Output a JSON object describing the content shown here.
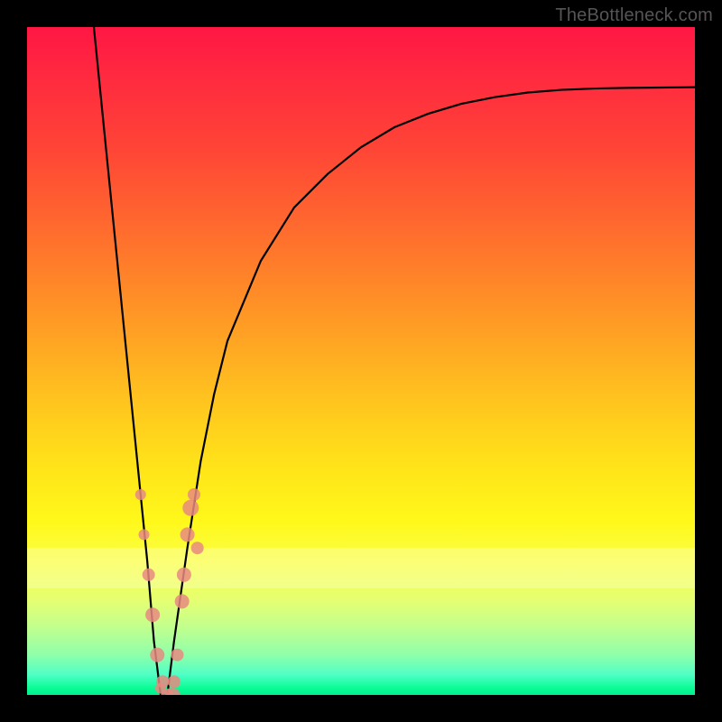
{
  "watermark": "TheBottleneck.com",
  "chart_data": {
    "type": "line",
    "title": "",
    "xlabel": "",
    "ylabel": "",
    "xlim": [
      0,
      100
    ],
    "ylim": [
      0,
      100
    ],
    "grid": false,
    "legend": false,
    "background_gradient": {
      "direction": "vertical",
      "stops": [
        {
          "pos": 0.0,
          "color": "#ff1744"
        },
        {
          "pos": 0.3,
          "color": "#ff6a2e"
        },
        {
          "pos": 0.55,
          "color": "#ffc11f"
        },
        {
          "pos": 0.74,
          "color": "#fff81a"
        },
        {
          "pos": 0.9,
          "color": "#c0ff8f"
        },
        {
          "pos": 1.0,
          "color": "#00f090"
        }
      ]
    },
    "series": [
      {
        "name": "bottleneck-curve",
        "color": "#000000",
        "x": [
          10,
          12,
          14,
          16,
          18,
          19,
          20,
          21,
          22,
          24,
          26,
          28,
          30,
          35,
          40,
          45,
          50,
          55,
          60,
          65,
          70,
          75,
          80,
          85,
          90,
          95,
          100
        ],
        "y": [
          100,
          80,
          60,
          40,
          20,
          8,
          0,
          0,
          8,
          22,
          35,
          45,
          53,
          65,
          73,
          78,
          82,
          85,
          87,
          88.5,
          89.5,
          90.2,
          90.6,
          90.8,
          90.9,
          90.95,
          91
        ]
      }
    ],
    "scatter_points": {
      "name": "marker-dots",
      "color": "#e88a80",
      "radius_px": [
        6,
        6,
        7,
        8,
        8,
        7,
        7,
        8,
        7,
        8,
        8,
        8,
        9,
        7,
        7,
        7,
        6
      ],
      "x": [
        17.0,
        17.5,
        18.2,
        18.8,
        19.5,
        20.3,
        21.0,
        21.8,
        22.5,
        23.2,
        23.5,
        24.0,
        24.5,
        25.0,
        25.5,
        22.0,
        20.0
      ],
      "y": [
        30,
        24,
        18,
        12,
        6,
        2,
        0,
        0,
        6,
        14,
        18,
        24,
        28,
        30,
        22,
        2,
        1
      ]
    }
  }
}
